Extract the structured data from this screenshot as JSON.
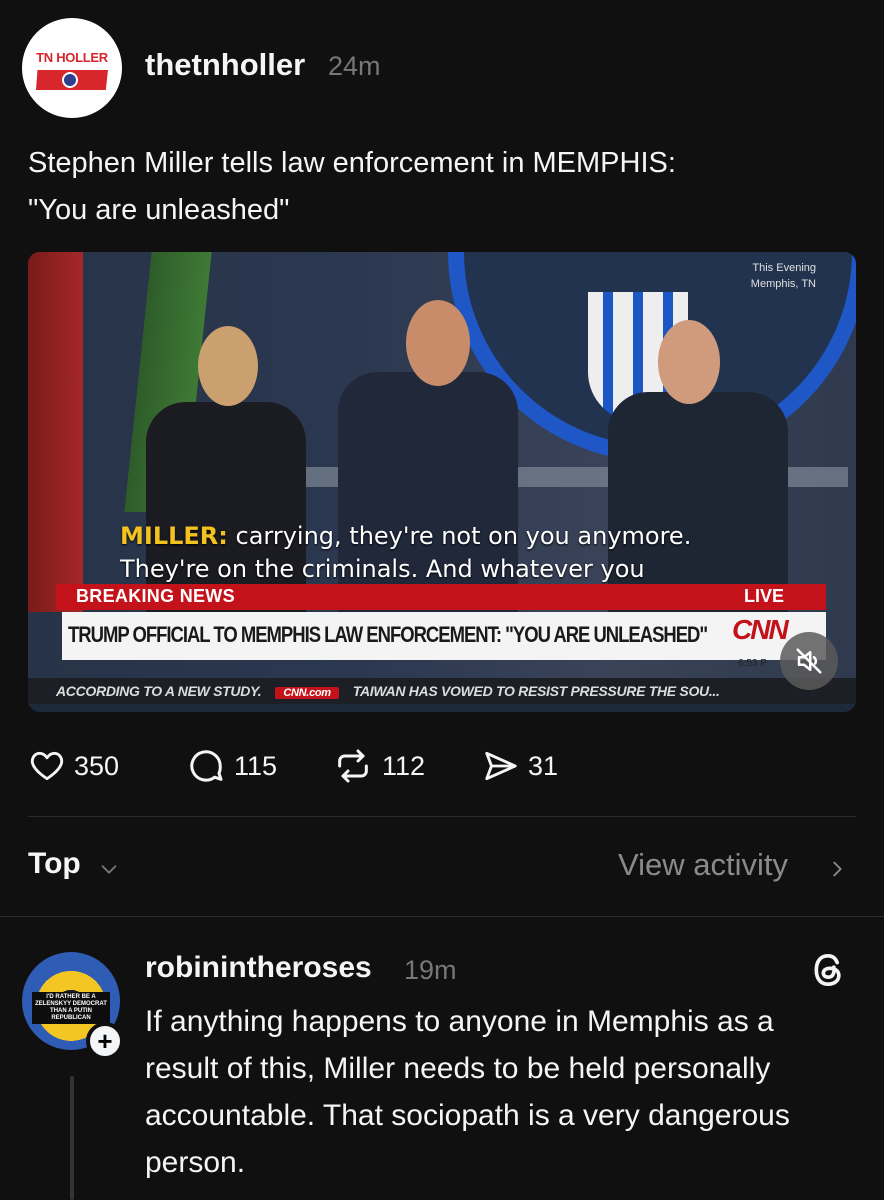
{
  "post": {
    "avatar_logo_text": "TN HOLLER",
    "username": "thetnholler",
    "time": "24m",
    "text": "Stephen Miller tells law enforcement in MEMPHIS:\n\"You are unleashed\"",
    "video": {
      "watermark_line1": "This Evening",
      "watermark_line2": "Memphis, TN",
      "caption_speaker": "MILLER:",
      "caption_text": " carrying, they're not on you anymore. They're on the criminals. And whatever you",
      "breaking_label": "BREAKING NEWS",
      "live_label": "LIVE",
      "headline": "TRUMP OFFICIAL TO MEMPHIS LAW ENFORCEMENT: \"YOU ARE UNLEASHED\"",
      "network_logo": "CNN",
      "clock": "6:53 P",
      "ticker_left": "ACCORDING TO A NEW STUDY.",
      "ticker_logo": "CNN.com",
      "ticker_right": "TAIWAN HAS VOWED TO RESIST PRESSURE THE SOU..."
    },
    "actions": {
      "likes": "350",
      "replies": "115",
      "reposts": "112",
      "shares": "31"
    }
  },
  "sort": {
    "label": "Top",
    "view_activity": "View activity"
  },
  "reply": {
    "avatar_text": "I'D RATHER BE A ZELENSKYY DEMOCRAT THAN A PUTIN REPUBLICAN",
    "username": "robinintheroses",
    "time": "19m",
    "text": "If anything happens to anyone in Memphis as a result of this, Miller needs to be held personally accountable. That sociopath is a very dangerous person."
  },
  "colors": {
    "background": "#101010",
    "text_primary": "#f3f5f7",
    "text_secondary": "#777777",
    "cnn_red": "#c4121a"
  },
  "icons": [
    "heart-icon",
    "comment-icon",
    "repost-icon",
    "share-icon",
    "chevron-down-icon",
    "chevron-right-icon",
    "threads-icon",
    "mute-icon",
    "plus-icon"
  ]
}
